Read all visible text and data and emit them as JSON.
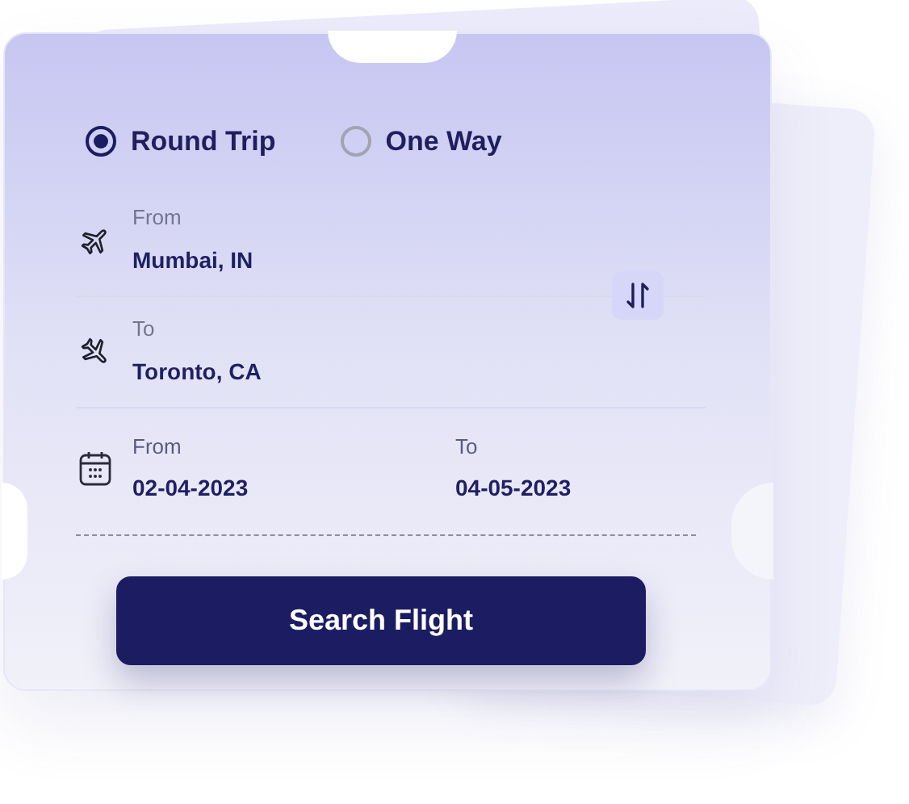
{
  "trip_types": [
    {
      "label": "Round Trip",
      "selected": true
    },
    {
      "label": "One Way",
      "selected": false
    }
  ],
  "route": [
    {
      "kind": "departure",
      "label": "From",
      "value": "Mumbai, IN"
    },
    {
      "kind": "arrival",
      "label": "To",
      "value": "Toronto, CA"
    }
  ],
  "dates": [
    {
      "label": "From",
      "value": "02-04-2023"
    },
    {
      "label": "To",
      "value": "04-05-2023"
    }
  ],
  "search_button": "Search Flight"
}
